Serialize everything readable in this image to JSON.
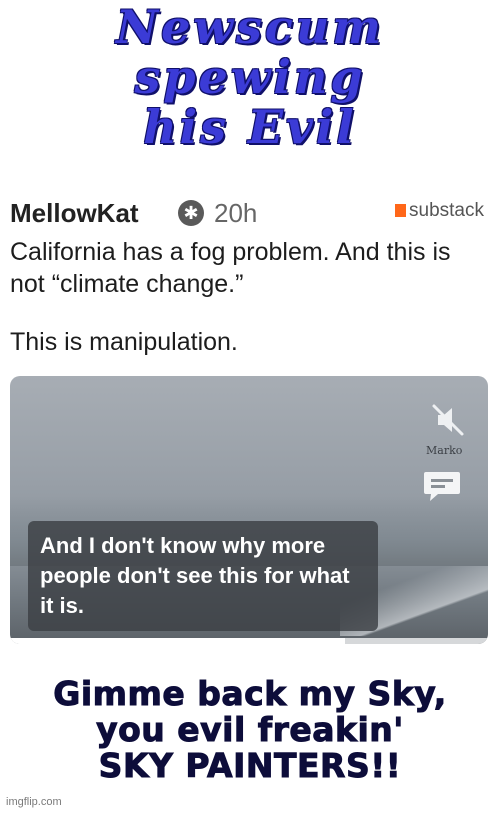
{
  "meme": {
    "top_caption": [
      "Newscum",
      "spewing",
      "his Evil"
    ],
    "bottom_caption": [
      "Gimme back my Sky,",
      "you evil freakin'",
      "SKY PAINTERS!!"
    ],
    "credit": "imgflip.com",
    "caption_color": "#3b3bd6"
  },
  "post": {
    "author": "MellowKat",
    "author_icon": "badge-icon",
    "time": "20h",
    "source": "substack",
    "source_color": "#ff6719",
    "text_line1": "California has a fog problem. And this is not “climate change.”",
    "text_line2": "This is manipulation."
  },
  "video": {
    "mute_icon": "speaker-muted-icon",
    "watermark": "Marko",
    "comment_icon": "comment-icon",
    "subtitle": "And I don't know why more people don't see this for what it is.",
    "progress_fraction": 0.7
  }
}
